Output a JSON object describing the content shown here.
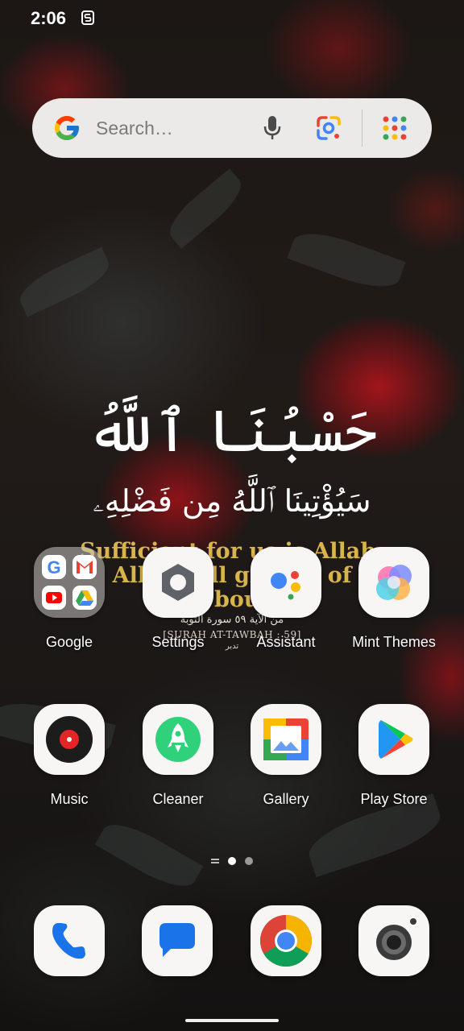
{
  "status_bar": {
    "time": "2:06",
    "notification_icon": "sync-s-icon"
  },
  "search": {
    "placeholder": "Search…",
    "icons": [
      "google-g-icon",
      "mic-icon",
      "google-lens-icon",
      "apps-grid-icon"
    ]
  },
  "wallpaper": {
    "arabic_line1": "حَسْبُنَا ٱللَّهُ",
    "arabic_line2": "سَيُؤْتِينَا ٱللَّهُ مِن فَضْلِهِۦ",
    "english_line1": "Sufficient for us is Allah;",
    "english_line2": "Allah will give us of",
    "english_line3": "His bounty",
    "ref_arabic": "من الآية ٥٩ سورة التوبة",
    "ref_english": "[SURAH AT-TAWBAH : 59]",
    "ref_small": "تدبر"
  },
  "apps_row1": [
    {
      "label": "Google",
      "icon": "google-folder-icon"
    },
    {
      "label": "Settings",
      "icon": "settings-gear-icon"
    },
    {
      "label": "Assistant",
      "icon": "assistant-icon"
    },
    {
      "label": "Mint Themes",
      "icon": "mint-themes-icon"
    }
  ],
  "apps_row2": [
    {
      "label": "Music",
      "icon": "music-disc-icon"
    },
    {
      "label": "Cleaner",
      "icon": "cleaner-rocket-icon"
    },
    {
      "label": "Gallery",
      "icon": "gallery-icon"
    },
    {
      "label": "Play Store",
      "icon": "play-store-icon"
    }
  ],
  "dock": [
    "phone-icon",
    "messages-icon",
    "chrome-icon",
    "camera-icon"
  ],
  "page_indicator": {
    "pages": 2,
    "current": 1
  },
  "colors": {
    "accent_blue": "#4285F4",
    "accent_red": "#EA4335",
    "accent_yellow": "#FBBC05",
    "accent_green": "#34A853",
    "quote_gold": "#d8b44c"
  }
}
